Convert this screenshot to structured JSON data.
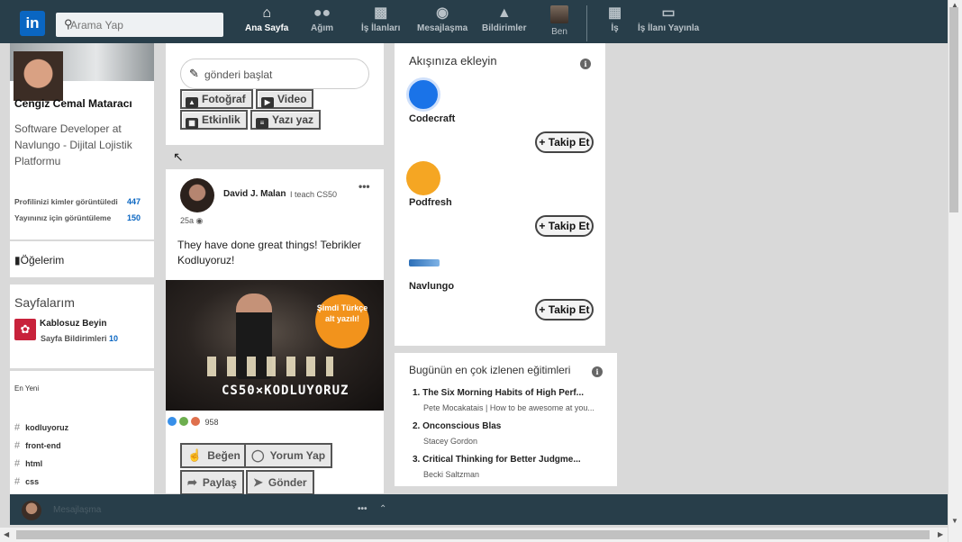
{
  "colors": {
    "nav_bg": "#283e4a",
    "accent": "#0a66c2",
    "badge_orange": "#f2931c"
  },
  "nav": {
    "logo": "in",
    "search": {
      "placeholder": "Arama Yap"
    },
    "items": [
      {
        "label": "Ana Sayfa",
        "icon": "home-icon",
        "active": true
      },
      {
        "label": "Ağım",
        "icon": "network-icon"
      },
      {
        "label": "İş İlanları",
        "icon": "briefcase-icon"
      },
      {
        "label": "Mesajlaşma",
        "icon": "chat-icon"
      },
      {
        "label": "Bildirimler",
        "icon": "bell-icon"
      },
      {
        "label": "Ben",
        "icon": "avatar"
      },
      {
        "label": "İş",
        "icon": "grid-icon"
      },
      {
        "label": "İş İlanı Yayınla",
        "icon": "post-job-icon"
      }
    ]
  },
  "profile": {
    "name": "Cengiz Cemal Mataracı",
    "headline": "Software Developer at Navlungo - Dijital Lojistik Platformu",
    "stats": [
      {
        "label": "Profilinizi kimler görüntüledi",
        "value": "447"
      },
      {
        "label": "Yayınınız için görüntüleme",
        "value": "150"
      }
    ],
    "saved_items": "Öğelerim"
  },
  "pages": {
    "title": "Sayfalarım",
    "page_name": "Kablosuz Beyin",
    "notifications_label": "Sayfa Bildirimleri",
    "notifications_count": "10"
  },
  "recent": {
    "label": "En Yeni",
    "hashtags": [
      "kodluyoruz",
      "front-end",
      "html",
      "css"
    ]
  },
  "share": {
    "placeholder": "gönderi başlat",
    "buttons": [
      "Fotoğraf",
      "Video",
      "Etkinlik",
      "Yazı yaz"
    ]
  },
  "post": {
    "author": "David J. Malan",
    "author_headline": "I teach CS50",
    "time": "25a",
    "text": "They have done great things! Tebrikler Kodluyoruz!",
    "image_badge": "Şimdi Türkçe alt yazılı!",
    "image_brand": "CS50×KODLUYORUZ",
    "reaction_count": "958",
    "actions": [
      "Beğen",
      "Yorum Yap",
      "Paylaş",
      "Gönder"
    ]
  },
  "follow": {
    "title": "Akışınıza ekleyin",
    "button_label": "+ Takip Et",
    "companies": [
      {
        "name": "Codecraft"
      },
      {
        "name": "Podfresh"
      },
      {
        "name": "Navlungo"
      }
    ]
  },
  "courses": {
    "title": "Bugünün en çok izlenen eğitimleri",
    "items": [
      {
        "title": "1. The Six Morning Habits of High Perf...",
        "sub": "Pete Mocakatais | How to be awesome at you..."
      },
      {
        "title": "2. Onconscious Blas",
        "sub": "Stacey Gordon"
      },
      {
        "title": "3. Critical Thinking for Better Judgme...",
        "sub": "Becki Saltzman"
      }
    ]
  },
  "messaging": {
    "label": "Mesajlaşma"
  }
}
